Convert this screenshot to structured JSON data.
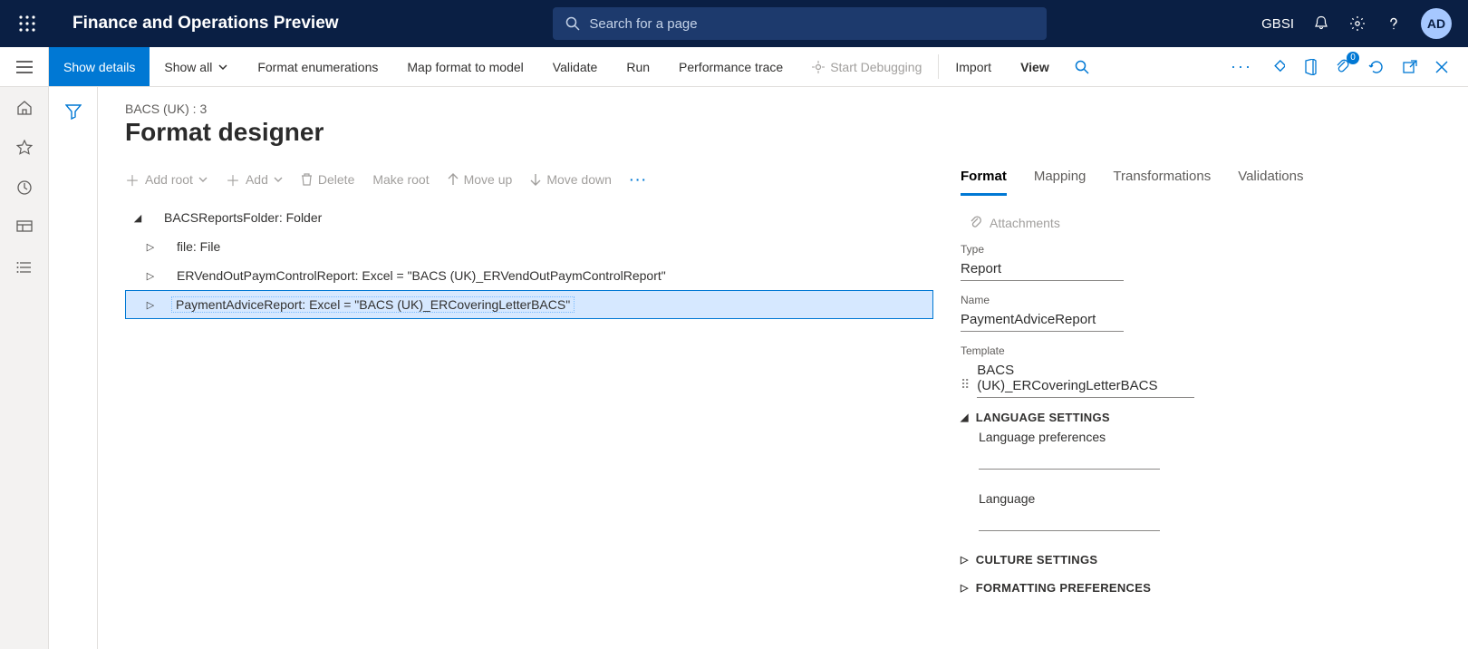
{
  "header": {
    "app_title": "Finance and Operations Preview",
    "search_placeholder": "Search for a page",
    "company": "GBSI",
    "avatar_initials": "AD"
  },
  "actionbar": {
    "show_details": "Show details",
    "show_all": "Show all",
    "format_enum": "Format enumerations",
    "map_format": "Map format to model",
    "validate": "Validate",
    "run": "Run",
    "perf_trace": "Performance trace",
    "start_debug": "Start Debugging",
    "import": "Import",
    "view": "View",
    "attachment_badge": "0"
  },
  "page": {
    "breadcrumb": "BACS (UK) : 3",
    "title": "Format designer"
  },
  "toolbar": {
    "add_root": "Add root",
    "add": "Add",
    "delete": "Delete",
    "make_root": "Make root",
    "move_up": "Move up",
    "move_down": "Move down"
  },
  "tree": {
    "root": "BACSReportsFolder: Folder",
    "children": [
      "file: File",
      "ERVendOutPaymControlReport: Excel = \"BACS (UK)_ERVendOutPaymControlReport\"",
      "PaymentAdviceReport: Excel = \"BACS (UK)_ERCoveringLetterBACS\""
    ],
    "selected_index": 2
  },
  "tabs": {
    "items": [
      "Format",
      "Mapping",
      "Transformations",
      "Validations"
    ],
    "active_index": 0
  },
  "details": {
    "attachments_label": "Attachments",
    "type_label": "Type",
    "type_value": "Report",
    "name_label": "Name",
    "name_value": "PaymentAdviceReport",
    "template_label": "Template",
    "template_value": "BACS (UK)_ERCoveringLetterBACS",
    "section_lang": "LANGUAGE SETTINGS",
    "lang_pref_label": "Language preferences",
    "language_label": "Language",
    "section_culture": "CULTURE SETTINGS",
    "section_formatting": "FORMATTING PREFERENCES"
  }
}
